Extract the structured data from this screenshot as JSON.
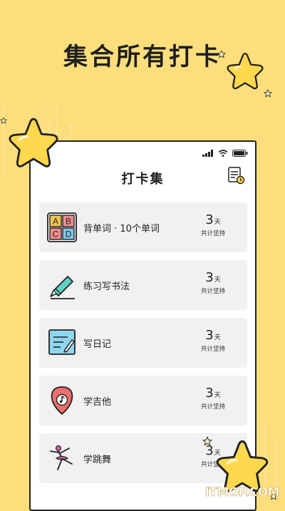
{
  "banner": {
    "headline": "集合所有打卡"
  },
  "app": {
    "title": "打卡集",
    "calendar_icon": "calendar-clock-icon",
    "status_icons": [
      "signal-icon",
      "wifi-icon",
      "battery-icon"
    ]
  },
  "habits": [
    {
      "label": "背单词 · 10个单词",
      "count": "3",
      "unit": "天",
      "caption": "共计坚持",
      "icon": "abcd-blocks-icon"
    },
    {
      "label": "练习写书法",
      "count": "3",
      "unit": "天",
      "caption": "共计坚持",
      "icon": "calligraphy-brush-icon"
    },
    {
      "label": "写日记",
      "count": "3",
      "unit": "天",
      "caption": "共计坚持",
      "icon": "diary-notepad-icon"
    },
    {
      "label": "学吉他",
      "count": "3",
      "unit": "天",
      "caption": "共计坚持",
      "icon": "guitar-pick-icon"
    },
    {
      "label": "学跳舞",
      "count": "3",
      "unit": "天",
      "caption": "共计坚持",
      "icon": "ballet-dancer-icon"
    }
  ],
  "watermark": "ITMOP.COM",
  "colors": {
    "background": "#FCDF7C",
    "star": "#FFD84D",
    "card": "#F1F1F1"
  }
}
